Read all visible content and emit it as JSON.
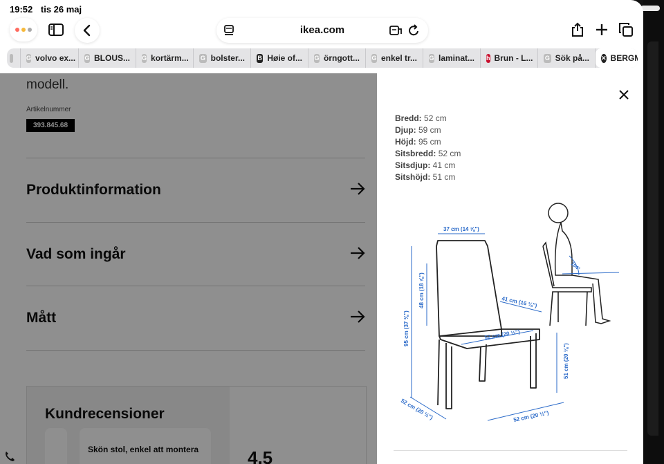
{
  "status": {
    "time": "19:52",
    "date": "tis 26 maj"
  },
  "browser": {
    "url": "ikea.com",
    "window_dots": [
      "#ff5f57",
      "#febc2e",
      "#28c840"
    ],
    "tabs": [
      {
        "label": "",
        "icon": "google"
      },
      {
        "label": "volvo ex...",
        "icon": "google"
      },
      {
        "label": "BLOUS...",
        "icon": "google"
      },
      {
        "label": "kortärm...",
        "icon": "google"
      },
      {
        "label": "bolster...",
        "icon": "google"
      },
      {
        "label": "Høie of...",
        "icon": "B"
      },
      {
        "label": "örngott...",
        "icon": "google"
      },
      {
        "label": "enkel tr...",
        "icon": "google"
      },
      {
        "label": "laminat...",
        "icon": "google"
      },
      {
        "label": "Brun - L...",
        "icon": "h"
      },
      {
        "label": "Sök på...",
        "icon": "google"
      },
      {
        "label": "BERGM...",
        "icon": "close",
        "active": true
      }
    ]
  },
  "page": {
    "model_text": "modell.",
    "article_label": "Artikelnummer",
    "article_number": "393.845.68",
    "sections": [
      "Produktinformation",
      "Vad som ingår",
      "Mått"
    ],
    "reviews_title": "Kundrecensioner",
    "review_snippet": "Skön stol, enkel att montera",
    "rating": "4.5"
  },
  "panel": {
    "specs": [
      {
        "label": "Bredd:",
        "value": "52 cm"
      },
      {
        "label": "Djup:",
        "value": "59 cm"
      },
      {
        "label": "Höjd:",
        "value": "95 cm"
      },
      {
        "label": "Sitsbredd:",
        "value": "52 cm"
      },
      {
        "label": "Sitsdjup:",
        "value": "41 cm"
      },
      {
        "label": "Sitshöjd:",
        "value": "51 cm"
      }
    ],
    "diagram_labels": {
      "back_width": "37 cm (14 ⅝\")",
      "back_height": "48 cm (18 ⅞\")",
      "total_height": "95 cm (37 ⅜\")",
      "seat_depth": "41 cm (16 ⅛\")",
      "seat_width": "52 cm (20 ½\")",
      "seat_height": "51 cm (20 ⅛\")",
      "base_depth": "52 cm (20 ½\")",
      "base_width": "52 cm (20 ½\")",
      "angle": "104°"
    }
  }
}
